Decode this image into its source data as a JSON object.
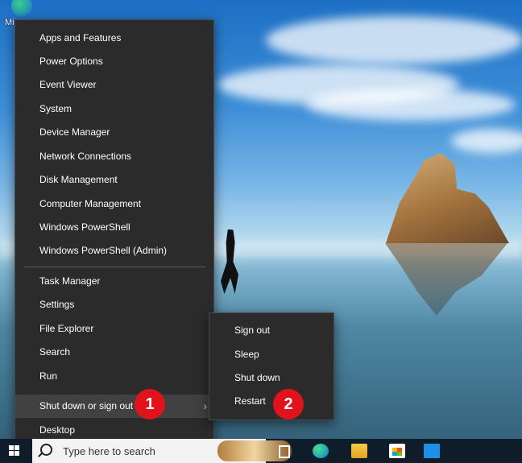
{
  "desktop": {
    "icon_label": "Mi"
  },
  "menu": {
    "items": [
      "Apps and Features",
      "Power Options",
      "Event Viewer",
      "System",
      "Device Manager",
      "Network Connections",
      "Disk Management",
      "Computer Management",
      "Windows PowerShell",
      "Windows PowerShell (Admin)",
      "Task Manager",
      "Settings",
      "File Explorer",
      "Search",
      "Run",
      "Shut down or sign out",
      "Desktop"
    ],
    "submenu_arrow": "›"
  },
  "submenu": {
    "items": [
      "Sign out",
      "Sleep",
      "Shut down",
      "Restart"
    ]
  },
  "annotations": {
    "badge1": "1",
    "badge2": "2",
    "color": "#e0131d"
  },
  "taskbar": {
    "search_placeholder": "Type here to search",
    "icons": [
      "windows-start-icon",
      "search-icon",
      "task-view-icon",
      "edge-icon",
      "file-explorer-icon",
      "store-icon",
      "mail-icon"
    ]
  },
  "colors": {
    "menu_bg": "#2b2b2b",
    "menu_hover": "#414141",
    "taskbar_bg": "#0f1d2b"
  }
}
